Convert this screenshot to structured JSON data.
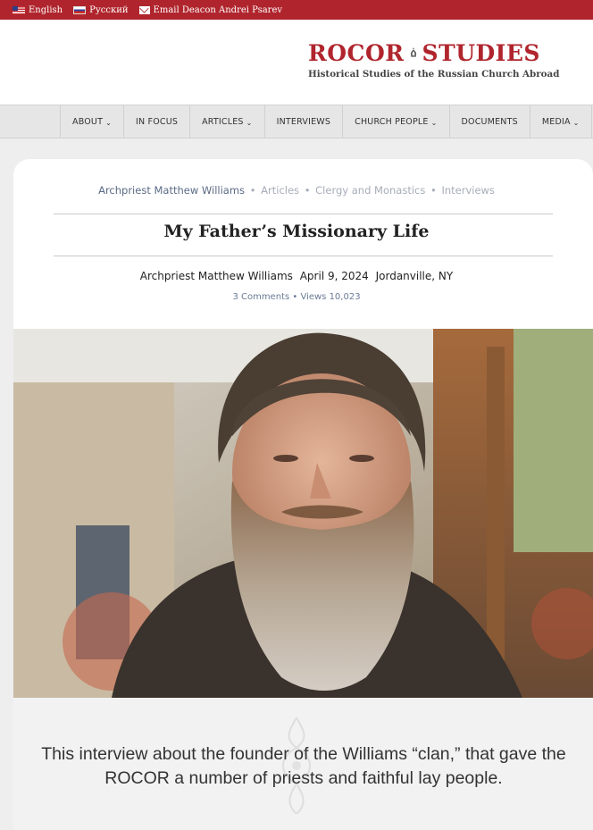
{
  "topbar": {
    "lang_en": "English",
    "lang_ru": "Русский",
    "email": "Email Deacon Andrei Psarev",
    "bg_color": "#b0252d"
  },
  "logo": {
    "word_left": "ROCOR",
    "word_right": "STUDIES",
    "tagline": "Historical Studies of the Russian Church Abroad",
    "icon": "onion-dome-icon",
    "brand_color": "#b0252d"
  },
  "nav": {
    "items": [
      {
        "label": "ABOUT",
        "dropdown": true
      },
      {
        "label": "IN FOCUS",
        "dropdown": false
      },
      {
        "label": "ARTICLES",
        "dropdown": true
      },
      {
        "label": "INTERVIEWS",
        "dropdown": false
      },
      {
        "label": "CHURCH PEOPLE",
        "dropdown": true
      },
      {
        "label": "DOCUMENTS",
        "dropdown": false
      },
      {
        "label": "MEDIA",
        "dropdown": true
      }
    ]
  },
  "article": {
    "breadcrumbs": [
      "Archpriest Matthew Williams",
      "Articles",
      "Clergy and Monastics",
      "Interviews"
    ],
    "title": "My Father’s Missionary Life",
    "author": "Archpriest Matthew Williams",
    "date": "April 9, 2024",
    "location": "Jordanville, NY",
    "comments": "3 Comments",
    "views": "Views 10,023",
    "photo_icon": "portrait-photo",
    "intro": "This interview about the founder of the Williams “clan,” that gave the ROCOR a number of priests and faithful lay people."
  }
}
